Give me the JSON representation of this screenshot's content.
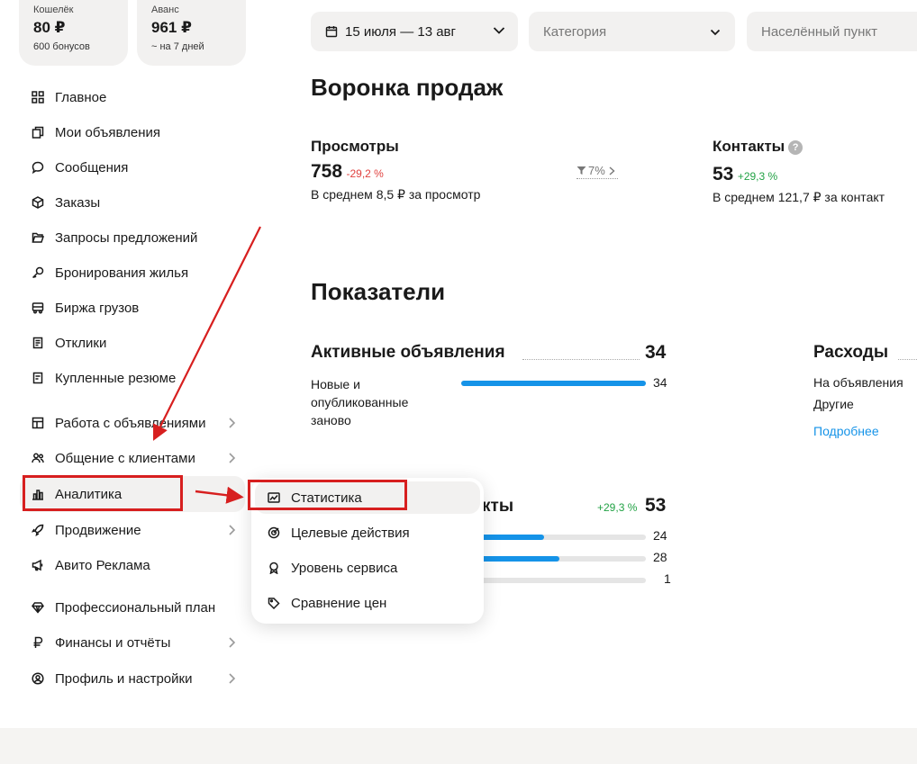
{
  "wallets": [
    {
      "label": "Кошелёк",
      "amount": "80 ₽",
      "sub": "600 бонусов"
    },
    {
      "label": "Аванс",
      "amount": "961 ₽",
      "sub": "~ на 7 дней"
    }
  ],
  "sidebar": {
    "items": [
      {
        "label": "Главное",
        "icon": "grid-icon"
      },
      {
        "label": "Мои объявления",
        "icon": "copy-icon"
      },
      {
        "label": "Сообщения",
        "icon": "chat-bubble-icon"
      },
      {
        "label": "Заказы",
        "icon": "box-icon"
      },
      {
        "label": "Запросы предложений",
        "icon": "folder-open-icon"
      },
      {
        "label": "Бронирования жилья",
        "icon": "key-icon"
      },
      {
        "label": "Биржа грузов",
        "icon": "truck-icon"
      },
      {
        "label": "Отклики",
        "icon": "document-icon"
      },
      {
        "label": "Купленные резюме",
        "icon": "resume-icon"
      },
      {
        "label": "Работа с объявлениями",
        "icon": "layout-icon"
      },
      {
        "label": "Общение с клиентами",
        "icon": "users-icon"
      },
      {
        "label": "Аналитика",
        "icon": "bar-chart-icon"
      },
      {
        "label": "Продвижение",
        "icon": "rocket-icon"
      },
      {
        "label": "Авито Реклама",
        "icon": "megaphone-icon"
      },
      {
        "label": "Профессиональный план",
        "icon": "diamond-icon"
      },
      {
        "label": "Финансы и отчёты",
        "icon": "ruble-icon"
      },
      {
        "label": "Профиль и настройки",
        "icon": "user-circle-icon"
      }
    ]
  },
  "filters": {
    "date_range": "15 июля — 13 авг",
    "category_placeholder": "Категория",
    "city_placeholder": "Населённый пункт"
  },
  "funnel": {
    "title": "Воронка продаж",
    "views": {
      "label": "Просмотры",
      "value": "758",
      "change": "-29,2 %",
      "avg": "В среднем 8,5 ₽ за просмотр"
    },
    "conversion": "7%",
    "contacts": {
      "label": "Контакты",
      "help": "?",
      "value": "53",
      "change": "+29,3 %",
      "avg": "В среднем 121,7 ₽ за контакт"
    }
  },
  "metrics": {
    "title": "Показатели",
    "active_ads": {
      "label": "Активные объявления",
      "total": "34",
      "rows": [
        {
          "label": "Новые и опубликованные заново",
          "value": "34",
          "fraction": 1.0
        }
      ]
    },
    "expenses": {
      "label": "Расходы",
      "rows": [
        "На объявления",
        "Другие"
      ],
      "more_link": "Подробнее"
    },
    "contacts": {
      "label_partial": "кты",
      "change": "+29,3 %",
      "total": "53",
      "rows": [
        {
          "value": "24",
          "fraction": 0.45
        },
        {
          "value": "28",
          "fraction": 0.53
        },
        {
          "value": "1",
          "fraction": 0.02
        }
      ]
    }
  },
  "popup": {
    "items": [
      {
        "label": "Статистика",
        "icon": "line-chart-icon"
      },
      {
        "label": "Целевые действия",
        "icon": "target-icon"
      },
      {
        "label": "Уровень сервиса",
        "icon": "medal-icon"
      },
      {
        "label": "Сравнение цен",
        "icon": "tag-icon"
      }
    ]
  },
  "colors": {
    "accent": "#1593e8",
    "negative": "#e0413f",
    "positive": "#22a245",
    "annotation": "#d71f1f"
  }
}
